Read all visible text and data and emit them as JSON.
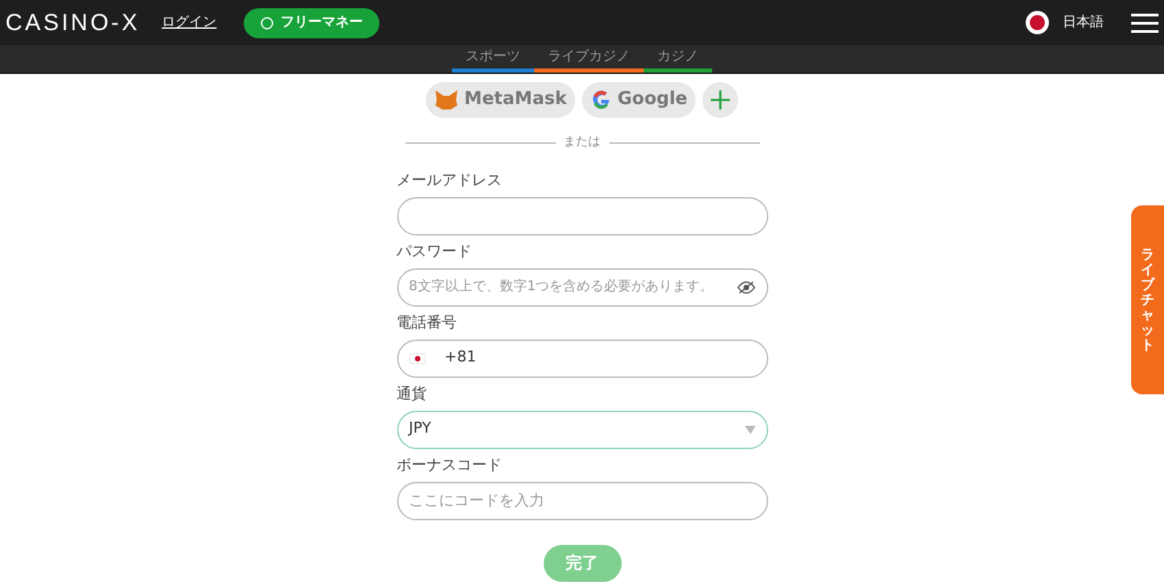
{
  "header": {
    "logo": "CASINO-X",
    "login": "ログイン",
    "free_money": "フリーマネー",
    "language": "日本語"
  },
  "nav_tabs": [
    {
      "label": "スポーツ",
      "color": "#1e7fd0"
    },
    {
      "label": "ライブカジノ",
      "color": "#f26b1d"
    },
    {
      "label": "カジノ",
      "color": "#21a038"
    }
  ],
  "social": [
    {
      "kind": "metamask",
      "label": "MetaMask"
    },
    {
      "kind": "google",
      "label": "Google"
    },
    {
      "kind": "more"
    }
  ],
  "divider": "または",
  "fields": [
    {
      "kind": "text",
      "label": "メールアドレス"
    },
    {
      "kind": "password",
      "label": "パスワード",
      "placeholder": "8文字以上で、数字1つを含める必要があります。"
    },
    {
      "kind": "phone",
      "label": "電話番号",
      "value": "+81"
    },
    {
      "kind": "select",
      "label": "通貨",
      "value": "JPY"
    },
    {
      "kind": "text",
      "label": "ボーナスコード",
      "placeholder": "ここにコードを入力"
    }
  ],
  "submit": {
    "label": "完了",
    "disabled": true
  },
  "live_chat": "ライブチャット"
}
